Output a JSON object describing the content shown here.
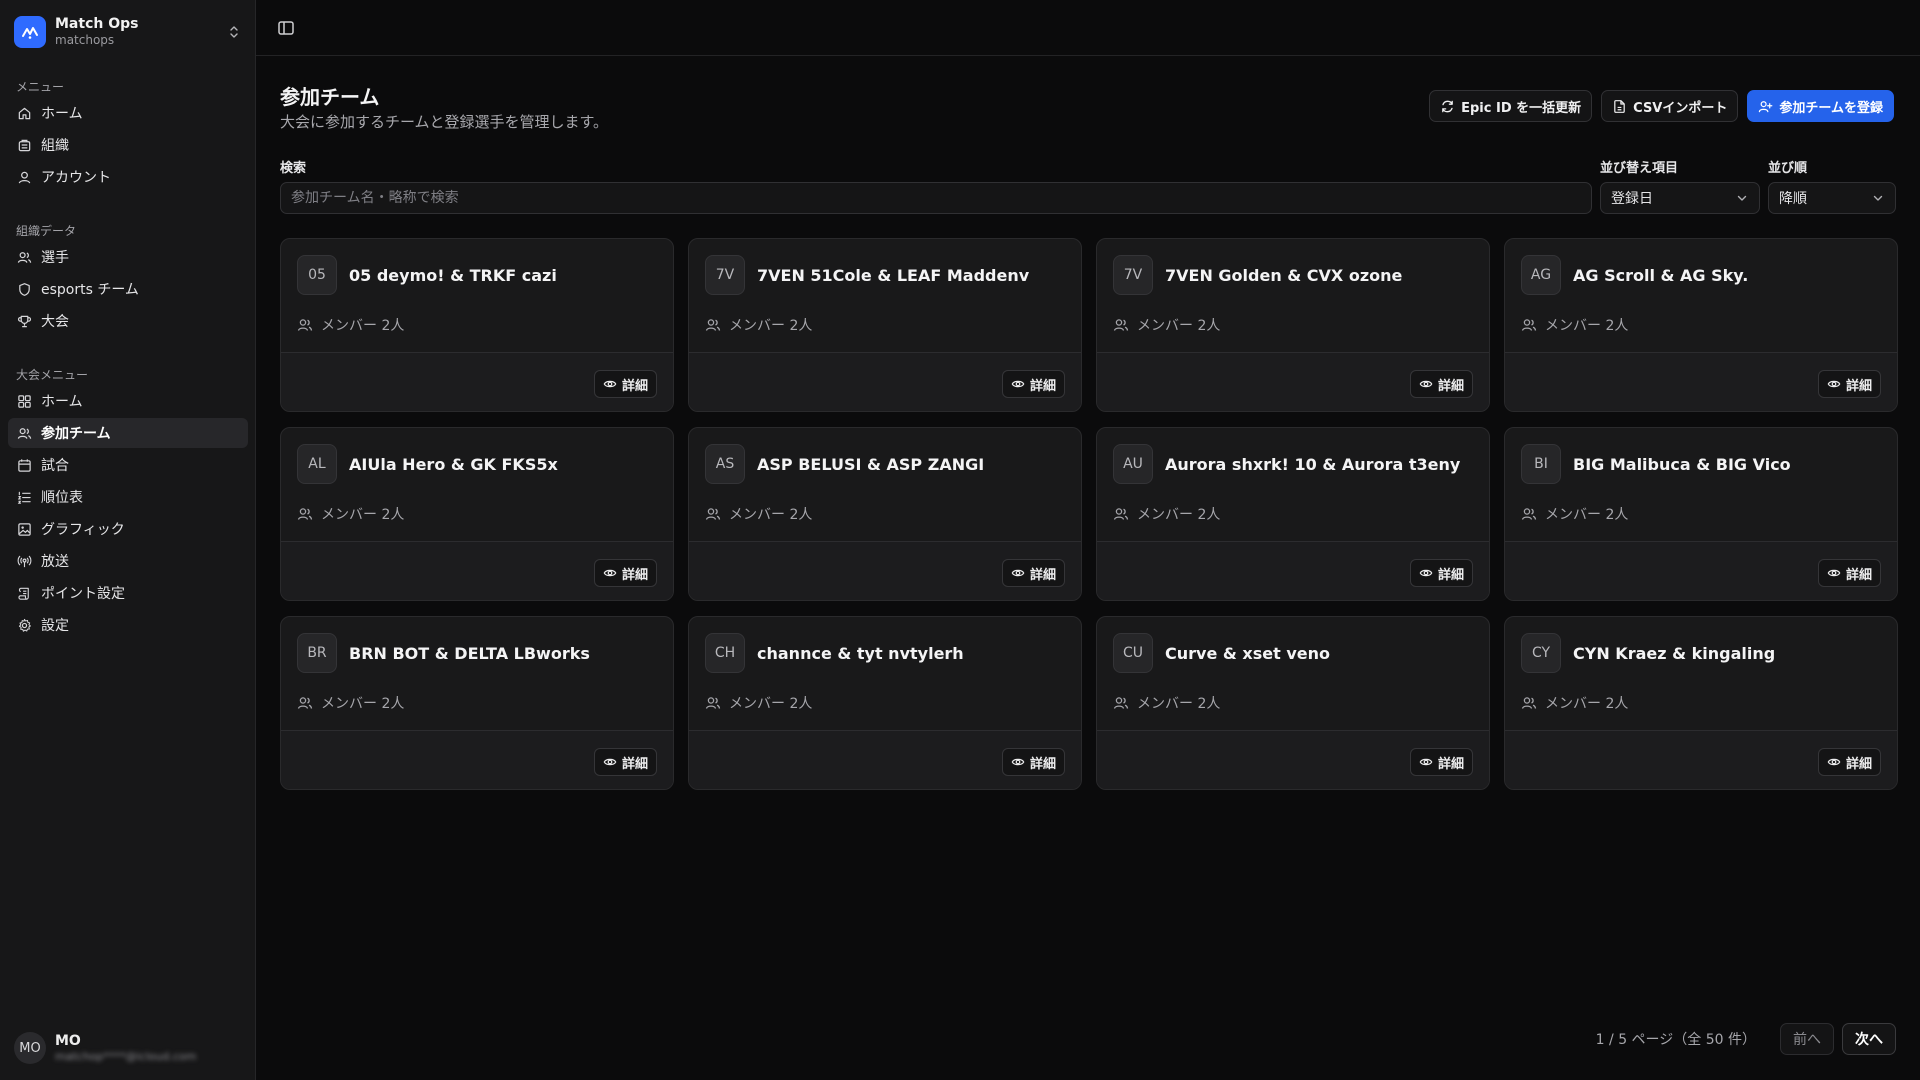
{
  "app": {
    "name": "Match Ops",
    "slug": "matchops"
  },
  "sidebar": {
    "groups": [
      {
        "label": "メニュー",
        "items": [
          {
            "label": "ホーム",
            "icon": "home-icon",
            "active": false
          },
          {
            "label": "組織",
            "icon": "building-icon",
            "active": false
          },
          {
            "label": "アカウント",
            "icon": "user-icon",
            "active": false
          }
        ]
      },
      {
        "label": "組織データ",
        "items": [
          {
            "label": "選手",
            "icon": "users-icon",
            "active": false
          },
          {
            "label": "esports チーム",
            "icon": "shield-icon",
            "active": false
          },
          {
            "label": "大会",
            "icon": "trophy-icon",
            "active": false
          }
        ]
      },
      {
        "label": "大会メニュー",
        "items": [
          {
            "label": "ホーム",
            "icon": "grid-icon",
            "active": false
          },
          {
            "label": "参加チーム",
            "icon": "users-icon",
            "active": true
          },
          {
            "label": "試合",
            "icon": "calendar-icon",
            "active": false
          },
          {
            "label": "順位表",
            "icon": "list-ordered-icon",
            "active": false
          },
          {
            "label": "グラフィック",
            "icon": "image-icon",
            "active": false
          },
          {
            "label": "放送",
            "icon": "broadcast-icon",
            "active": false
          },
          {
            "label": "ポイント設定",
            "icon": "scroll-icon",
            "active": false
          },
          {
            "label": "設定",
            "icon": "gear-icon",
            "active": false
          }
        ]
      }
    ],
    "user": {
      "initials": "MO",
      "name": "MO",
      "email": "matchop****@icloud.com"
    }
  },
  "page": {
    "title": "参加チーム",
    "subtitle": "大会に参加するチームと登録選手を管理します。"
  },
  "actions": {
    "epic_update": "Epic ID を一括更新",
    "csv_import": "CSVインポート",
    "register": "参加チームを登録"
  },
  "filters": {
    "search_label": "検索",
    "search_placeholder": "参加チーム名・略称で検索",
    "search_value": "",
    "sort_label": "並び替え項目",
    "sort_value": "登録日",
    "order_label": "並び順",
    "order_value": "降順"
  },
  "teams": [
    {
      "abbr": "05",
      "name": "05 deymo! & TRKF cazi",
      "members": "メンバー 2人",
      "detail": "詳細"
    },
    {
      "abbr": "7V",
      "name": "7VEN 51Cole & LEAF Maddenv",
      "members": "メンバー 2人",
      "detail": "詳細"
    },
    {
      "abbr": "7V",
      "name": "7VEN Golden & CVX ozone",
      "members": "メンバー 2人",
      "detail": "詳細"
    },
    {
      "abbr": "AG",
      "name": "AG Scroll & AG Sky.",
      "members": "メンバー 2人",
      "detail": "詳細"
    },
    {
      "abbr": "AL",
      "name": "AIUla Hero & GK FKS5x",
      "members": "メンバー 2人",
      "detail": "詳細"
    },
    {
      "abbr": "AS",
      "name": "ASP BELUSI & ASP ZANGI",
      "members": "メンバー 2人",
      "detail": "詳細"
    },
    {
      "abbr": "AU",
      "name": "Aurora shxrk! 10 & Aurora t3eny",
      "members": "メンバー 2人",
      "detail": "詳細"
    },
    {
      "abbr": "BI",
      "name": "BIG Malibuca & BIG Vico",
      "members": "メンバー 2人",
      "detail": "詳細"
    },
    {
      "abbr": "BR",
      "name": "BRN BOT & DELTA LBworks",
      "members": "メンバー 2人",
      "detail": "詳細"
    },
    {
      "abbr": "CH",
      "name": "channce & tyt nvtylerh",
      "members": "メンバー 2人",
      "detail": "詳細"
    },
    {
      "abbr": "CU",
      "name": "Curve & xset veno",
      "members": "メンバー 2人",
      "detail": "詳細"
    },
    {
      "abbr": "CY",
      "name": "CYN Kraez & kingaling",
      "members": "メンバー 2人",
      "detail": "詳細"
    }
  ],
  "pagination": {
    "info": "1 / 5 ページ（全 50 件）",
    "prev": "前へ",
    "next": "次へ"
  },
  "colors": {
    "accent": "#2563eb",
    "brand_logo": "#2f6bff",
    "background": "#0b0b0c",
    "sidebar": "#171718",
    "card": "#19191a"
  }
}
